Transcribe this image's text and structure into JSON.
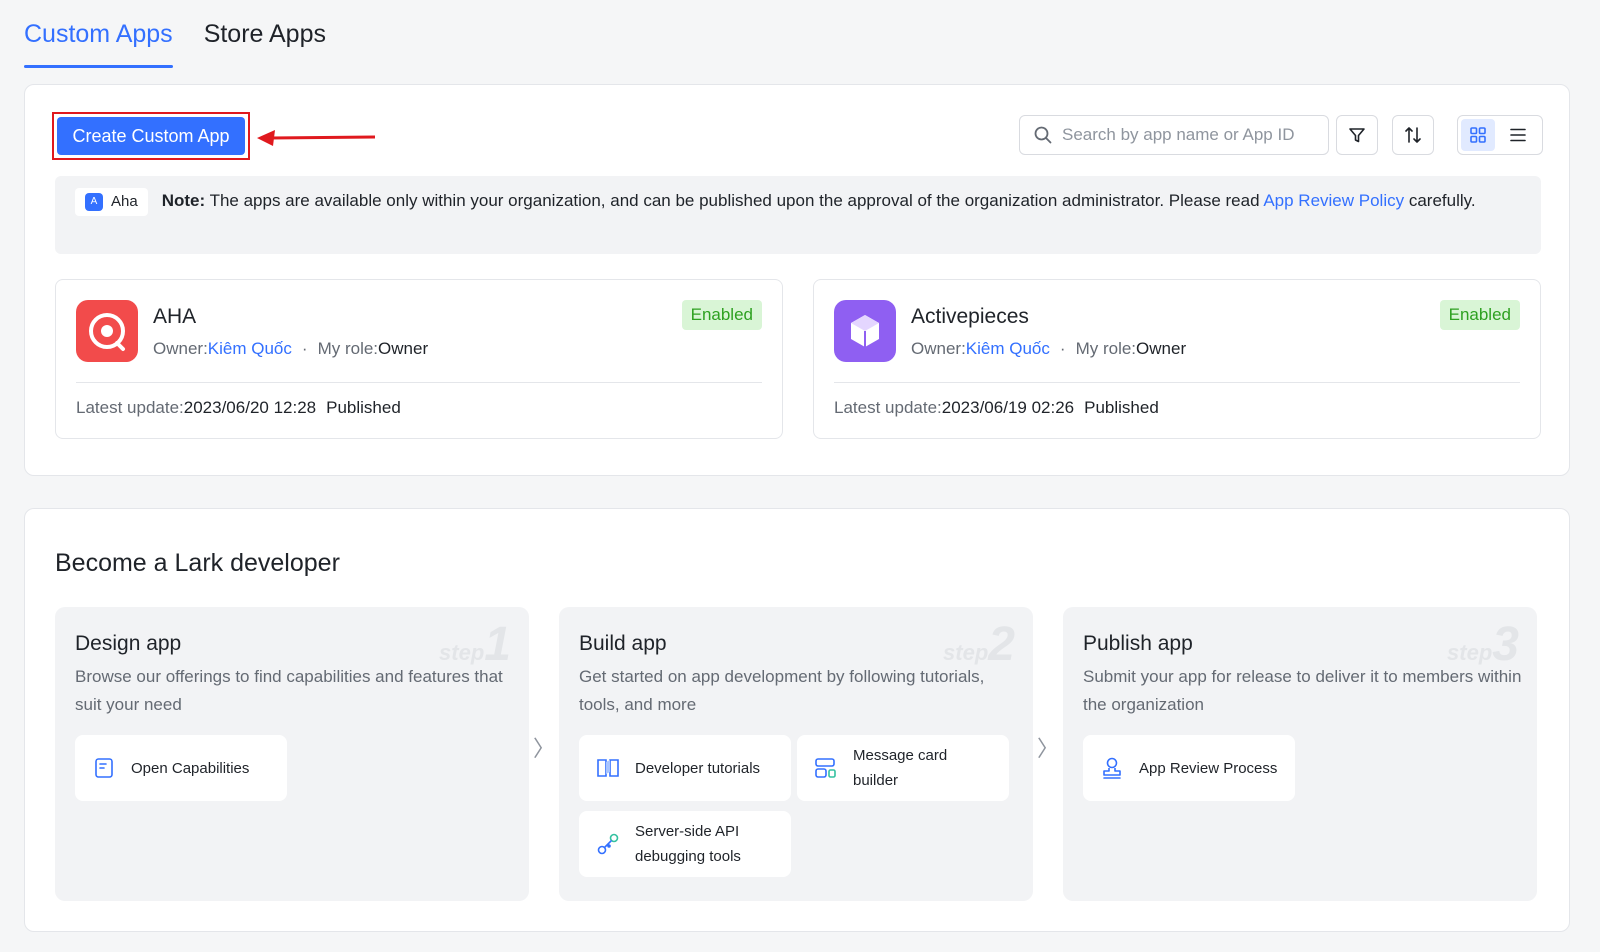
{
  "tabs": [
    {
      "label": "Custom Apps",
      "active": true
    },
    {
      "label": "Store Apps",
      "active": false
    }
  ],
  "toolbar": {
    "create_label": "Create Custom App",
    "search_placeholder": "Search by app name or App ID",
    "filter_icon": "filter-icon",
    "sort_icon": "sort-icon",
    "grid_icon": "grid-view-icon",
    "list_icon": "list-view-icon"
  },
  "note": {
    "org_badge": "A",
    "org_name": "Aha",
    "prefix": "Note:",
    "text": " The apps are available only within your organization, and can be published upon the approval of the organization administrator. Please read ",
    "link": "App Review Policy",
    "suffix": " carefully."
  },
  "apps": [
    {
      "name": "AHA",
      "status": "Enabled",
      "owner_label": "Owner:",
      "owner": "Kiêm Quốc",
      "dot": "·",
      "role_label": "My role:",
      "role": "Owner",
      "update_label": "Latest update:",
      "update": "2023/06/20 12:28",
      "publish": "Published",
      "icon": "aha-app-icon",
      "color": "#f24b4b"
    },
    {
      "name": "Activepieces",
      "status": "Enabled",
      "owner_label": "Owner:",
      "owner": "Kiêm Quốc",
      "dot": "·",
      "role_label": "My role:",
      "role": "Owner",
      "update_label": "Latest update:",
      "update": "2023/06/19 02:26",
      "publish": "Published",
      "icon": "cube-app-icon",
      "color": "#8f5ff2"
    }
  ],
  "developer": {
    "title": "Become a Lark developer",
    "steps": [
      {
        "title": "Design app",
        "badge_word": "step",
        "badge_num": "1",
        "desc": "Browse our offerings to find capabilities and features that suit your need",
        "tools": [
          {
            "label": "Open Capabilities",
            "icon": "document-icon"
          }
        ]
      },
      {
        "title": "Build app",
        "badge_word": "step",
        "badge_num": "2",
        "desc": "Get started on app development by following tutorials, tools, and more",
        "tools": [
          {
            "label": "Developer tutorials",
            "icon": "book-icon"
          },
          {
            "label": "Message card builder",
            "icon": "card-builder-icon"
          },
          {
            "label": "Server-side API debugging tools",
            "icon": "api-debug-icon"
          }
        ]
      },
      {
        "title": "Publish app",
        "badge_word": "step",
        "badge_num": "3",
        "desc": "Submit your app for release to deliver it to members within the organization",
        "tools": [
          {
            "label": "App Review Process",
            "icon": "review-stamp-icon"
          }
        ]
      }
    ],
    "chevron": "〉"
  },
  "colors": {
    "accent": "#3370ff",
    "enabled_bg": "#d9f5d6",
    "enabled_text": "#2ea121",
    "highlight": "#e0191e"
  }
}
